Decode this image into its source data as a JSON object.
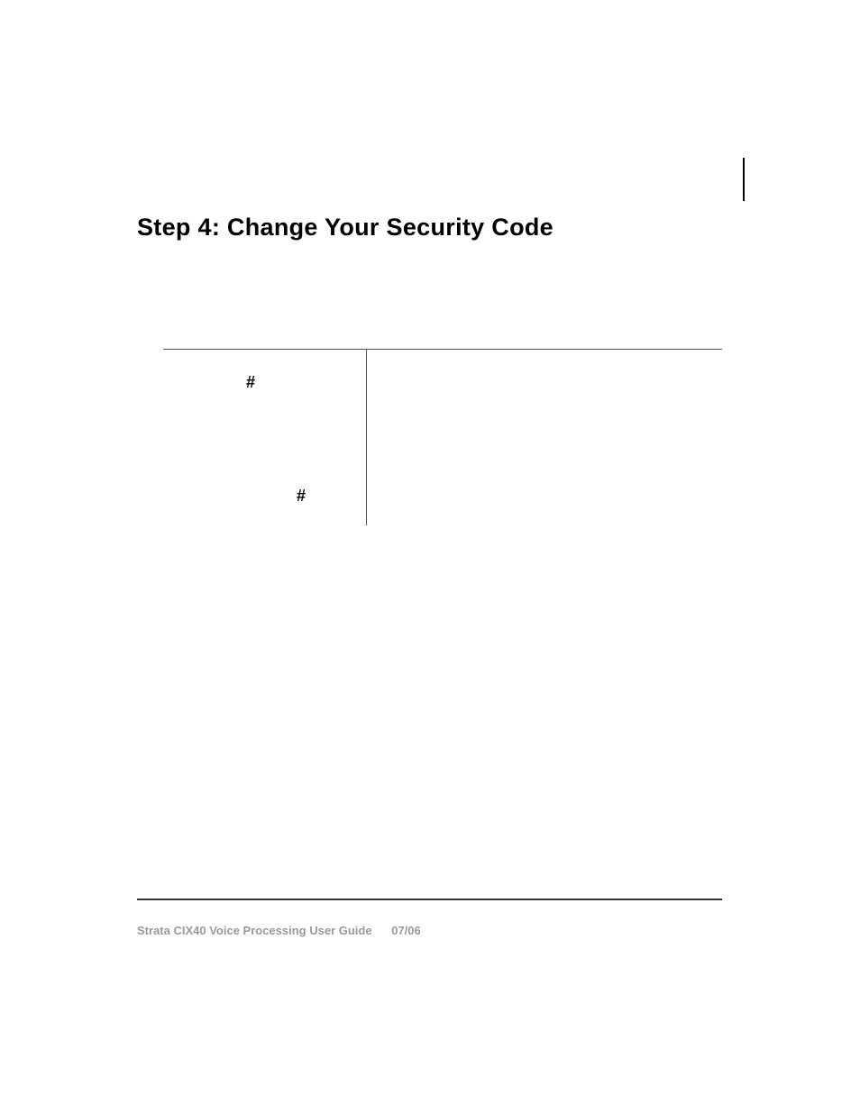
{
  "heading": "Step 4:  Change Your Security Code",
  "symbols": {
    "hash1": "#",
    "hash2": "#"
  },
  "footer": {
    "title": "Strata CIX40 Voice Processing User Guide",
    "date": "07/06"
  }
}
